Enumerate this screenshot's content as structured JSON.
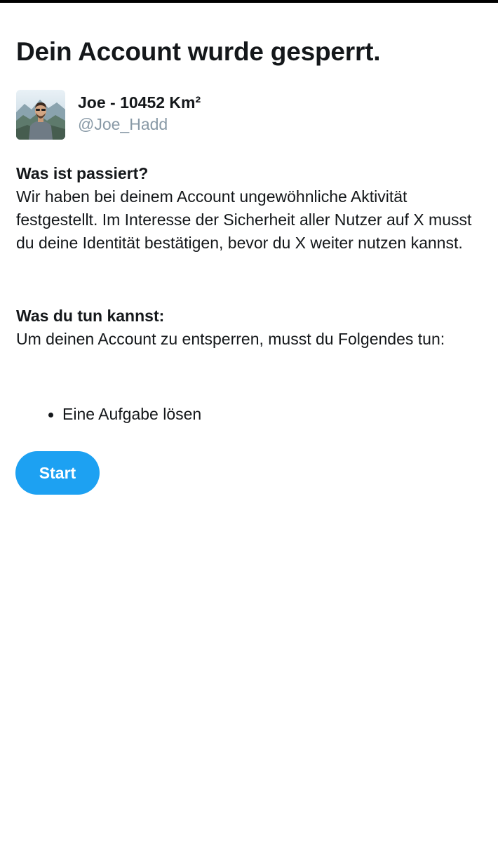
{
  "page_title": "Dein Account wurde gesperrt.",
  "profile": {
    "display_name": "Joe - 10452 Km²",
    "handle": "@Joe_Hadd"
  },
  "what_happened": {
    "heading": "Was ist passiert?",
    "text": "Wir haben bei deinem Account ungewöhnliche Aktivität festgestellt. Im Interesse der Sicherheit aller Nutzer auf X musst du deine Identität bestätigen, bevor du X weiter nutzen kannst."
  },
  "what_to_do": {
    "heading": "Was du tun kannst:",
    "text": "Um deinen Account zu entsperren, musst du Folgendes tun:",
    "steps": [
      "Eine Aufgabe lösen"
    ]
  },
  "start_button": {
    "label": "Start"
  },
  "colors": {
    "accent": "#1da1f2",
    "text": "#14171a",
    "muted": "#8899a6"
  }
}
